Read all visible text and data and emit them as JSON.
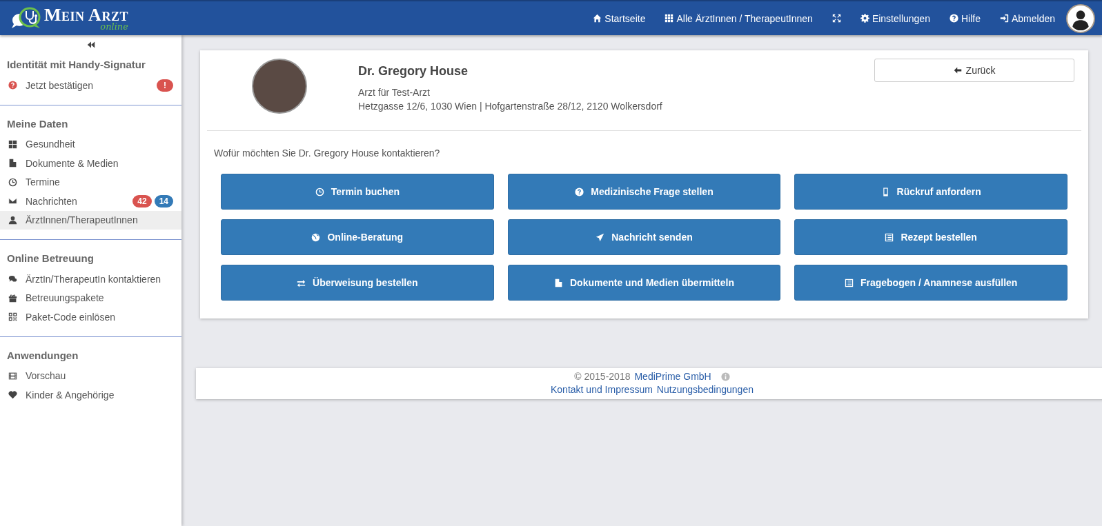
{
  "header": {
    "logo": {
      "title": "Mein Arzt",
      "subtitle": "online"
    },
    "nav": [
      {
        "kind": "link",
        "label": "Startseite"
      },
      {
        "kind": "link",
        "label": "Alle ÄrztInnen / TherapeutInnen"
      },
      {
        "kind": "icon"
      },
      {
        "kind": "link",
        "label": "Einstellungen"
      },
      {
        "kind": "link",
        "label": "Hilfe"
      },
      {
        "kind": "link",
        "label": "Abmelden"
      }
    ]
  },
  "sidebar": {
    "sections": [
      {
        "title": "Identität mit Handy-Signatur",
        "items": [
          {
            "label": "Jetzt bestätigen",
            "selected": false,
            "alert": true,
            "badges": [
              {
                "text": "!",
                "color": "#d9534f"
              }
            ]
          }
        ]
      },
      {
        "title": "Meine Daten",
        "items": [
          {
            "label": "Gesundheit",
            "selected": false
          },
          {
            "label": "Dokumente & Medien",
            "selected": false
          },
          {
            "label": "Termine",
            "selected": false
          },
          {
            "label": "Nachrichten",
            "selected": false,
            "badges": [
              {
                "text": "42",
                "color": "#d9534f"
              },
              {
                "text": "14",
                "color": "#337ab7"
              }
            ]
          },
          {
            "label": "ÄrztInnen/TherapeutInnen",
            "selected": true
          }
        ]
      },
      {
        "title": "Online Betreuung",
        "items": [
          {
            "label": "ÄrztIn/TherapeutIn kontaktieren",
            "selected": false
          },
          {
            "label": "Betreuungspakete",
            "selected": false
          },
          {
            "label": "Paket-Code einlösen",
            "selected": false
          }
        ]
      },
      {
        "title": "Anwendungen",
        "items": [
          {
            "label": "Vorschau",
            "selected": false
          },
          {
            "label": "Kinder & Angehörige",
            "selected": false
          }
        ]
      }
    ]
  },
  "doctor": {
    "name": "Dr. Gregory House",
    "specialty": "Arzt für Test-Arzt",
    "address": "Hetzgasse 12/6, 1030 Wien | Hofgartenstraße 28/12, 2120 Wolkersdorf"
  },
  "back_button": "Zurück",
  "question": "Wofür möchten Sie Dr. Gregory House kontaktieren?",
  "actions": [
    {
      "label": "Termin buchen"
    },
    {
      "label": "Medizinische Frage stellen"
    },
    {
      "label": "Rückruf anfordern"
    },
    {
      "label": "Online-Beratung"
    },
    {
      "label": "Nachricht senden"
    },
    {
      "label": "Rezept bestellen"
    },
    {
      "label": "Überweisung bestellen"
    },
    {
      "label": "Dokumente und Medien übermitteln"
    },
    {
      "label": "Fragebogen / Anamnese ausfüllen"
    }
  ],
  "footer": {
    "copyright": "© 2015-2018",
    "company": "MediPrime GmbH",
    "links": [
      "Kontakt und Impressum",
      "Nutzungsbedingungen"
    ]
  }
}
